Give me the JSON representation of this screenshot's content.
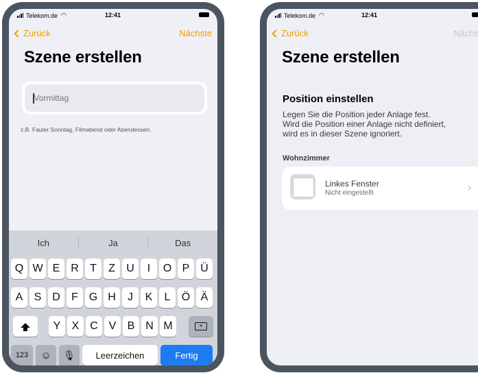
{
  "status": {
    "carrier": "Telekom.de",
    "time": "12:41"
  },
  "left": {
    "back_label": "Zurück",
    "next_label": "Nächste",
    "title": "Szene erstellen",
    "input_placeholder": "Vormittag",
    "hint": "z.B. Fauler Sonntag, Filmabend oder Abendessen.",
    "keyboard": {
      "suggestions": [
        "Ich",
        "Ja",
        "Das"
      ],
      "row1": [
        "Q",
        "W",
        "E",
        "R",
        "T",
        "Z",
        "U",
        "I",
        "O",
        "P",
        "Ü"
      ],
      "row2": [
        "A",
        "S",
        "D",
        "F",
        "G",
        "H",
        "J",
        "K",
        "L",
        "Ö",
        "Ä"
      ],
      "row3": [
        "Y",
        "X",
        "C",
        "V",
        "B",
        "N",
        "M"
      ],
      "numbers_label": "123",
      "space_label": "Leerzeichen",
      "done_label": "Fertig",
      "shift_icon": "shift-icon",
      "delete_icon": "delete-icon",
      "emoji_icon": "emoji-icon",
      "mic_icon": "microphone-icon",
      "done_color": "#1e7cf2"
    }
  },
  "right": {
    "back_label": "Zurück",
    "next_label": "Nächste",
    "title": "Szene erstellen",
    "section_title": "Position einstellen",
    "description_lines": [
      "Legen Sie die Position jeder Anlage fest.",
      "Wird die Position einer Anlage nicht definiert,",
      "wird es in dieser Szene ignoriert."
    ],
    "room": "Wohnzimmer",
    "device": {
      "name": "Linkes Fenster",
      "status": "Nicht eingestellt",
      "icon": "window-icon"
    }
  },
  "colors": {
    "accent": "#f29b00",
    "disabled": "#c4c6cb",
    "phone_frame": "#4a5560"
  }
}
